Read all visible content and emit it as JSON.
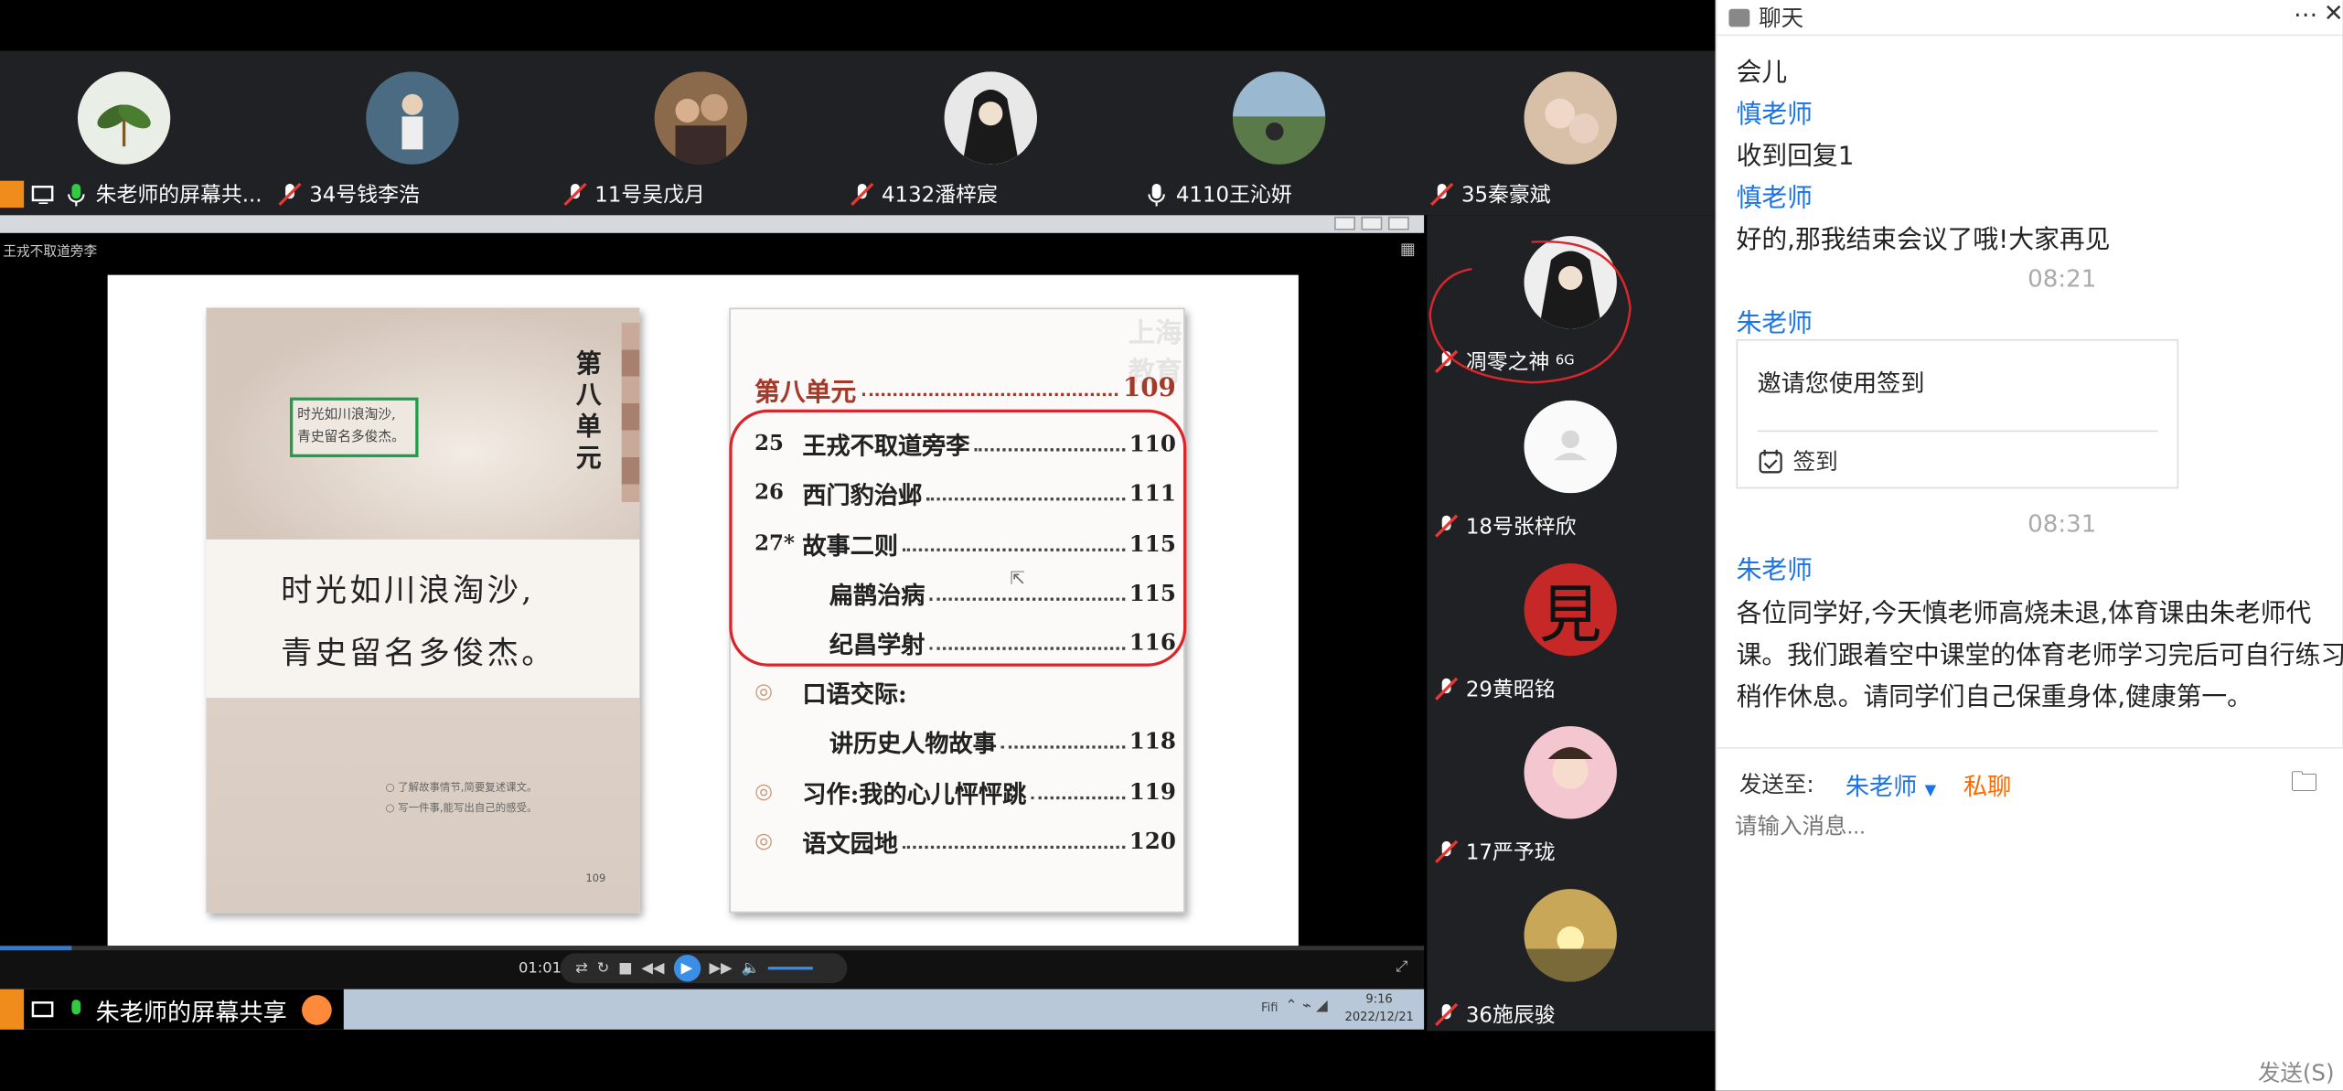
{
  "participants_top": [
    {
      "name": "朱老师的屏幕共...",
      "muted": false,
      "presenter": true
    },
    {
      "name": "34号钱李浩",
      "muted": true
    },
    {
      "name": "11号吴戊月",
      "muted": true
    },
    {
      "name": "4132潘梓宸",
      "muted": true
    },
    {
      "name": "4110王沁妍",
      "muted": false
    },
    {
      "name": "35秦豪斌",
      "muted": true
    }
  ],
  "participants_side": [
    {
      "name": "凋零之神",
      "badge": "6G",
      "muted": true
    },
    {
      "name": "18号张梓欣",
      "muted": true
    },
    {
      "name": "29黄昭铭",
      "muted": true,
      "avatar_char": "見"
    },
    {
      "name": "17严予珑",
      "muted": true
    },
    {
      "name": "36施辰骏",
      "muted": true
    }
  ],
  "player": {
    "caption": "王戎不取道旁李",
    "time": "01:01",
    "watermark": "上海教育",
    "presenter_label": "朱老师的屏幕共享",
    "clock_time": "9:16",
    "clock_date": "2022/12/21",
    "lang": "Fifi"
  },
  "slide_left": {
    "unit_vertical": "第八单元",
    "stamp_line1": "时光如川浪淘沙,",
    "stamp_line2": "青史留名多俊杰。",
    "poem_line1": "时光如川浪淘沙,",
    "poem_line2": "青史留名多俊杰。",
    "note1": "○ 了解故事情节,简要复述课文。",
    "note2": "○ 写一件事,能写出自己的感受。",
    "page": "109"
  },
  "toc": {
    "header": {
      "title": "第八单元",
      "page": "109"
    },
    "items": [
      {
        "num": "25",
        "title": "王戎不取道旁李",
        "page": "110"
      },
      {
        "num": "26",
        "title": "西门豹治邺",
        "page": "111"
      },
      {
        "num": "27*",
        "title": "故事二则",
        "page": "115"
      },
      {
        "num": "",
        "title": "扁鹊治病",
        "page": "115"
      },
      {
        "num": "",
        "title": "纪昌学射",
        "page": "116"
      },
      {
        "num": "◎",
        "title": "口语交际:",
        "page": ""
      },
      {
        "num": "",
        "title": "讲历史人物故事",
        "page": "118"
      },
      {
        "num": "◎",
        "title": "习作:我的心儿怦怦跳",
        "page": "119"
      },
      {
        "num": "◎",
        "title": "语文园地",
        "page": "120"
      }
    ]
  },
  "chat": {
    "title": "聊天",
    "messages": [
      {
        "type": "text",
        "text": "会儿"
      },
      {
        "type": "sender",
        "text": "慎老师"
      },
      {
        "type": "text",
        "text": "收到回复1"
      },
      {
        "type": "sender",
        "text": "慎老师"
      },
      {
        "type": "text",
        "text": "好的,那我结束会议了哦!大家再见"
      },
      {
        "type": "time",
        "text": "08:21"
      },
      {
        "type": "sender",
        "text": "朱老师"
      }
    ],
    "card": {
      "title": "邀请您使用签到",
      "action": "签到"
    },
    "time2": "08:31",
    "sender2": "朱老师",
    "long_lines": [
      "各位同学好,今天慎老师高烧未退,体育课由朱老师代",
      "课。我们跟着空中课堂的体育老师学习完后可自行练习",
      "稍作休息。请同学们自己保重身体,健康第一。"
    ],
    "send_to_label": "发送至:",
    "send_to_value": "朱老师",
    "private_label": "私聊",
    "input_placeholder": "请输入消息...",
    "send_button": "发送(S)"
  },
  "colors": {
    "accent": "#1a73e8",
    "private": "#ff6a00",
    "annotation_red": "#d9262c",
    "orange": "#f08c1c"
  }
}
